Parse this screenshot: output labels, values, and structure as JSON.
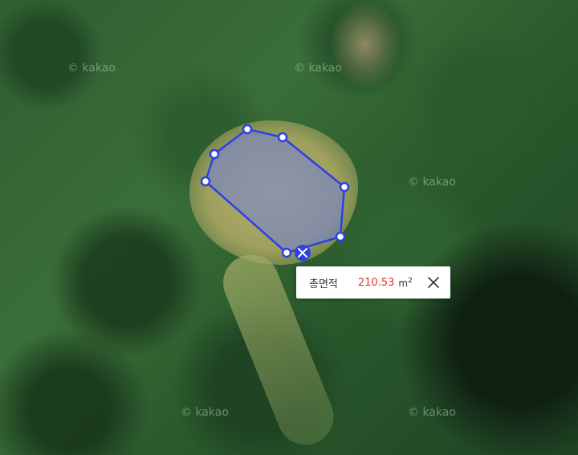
{
  "map": {
    "watermark_text": "© kakao"
  },
  "popup": {
    "label": "총면적",
    "value": "210.53",
    "unit": "m",
    "unit_sup": "2"
  },
  "colors": {
    "polygon_stroke": "#2f3fe6",
    "polygon_fill": "#6f7fd8",
    "area_value": "#e3342f"
  },
  "icons": {
    "vertex": "vertex-handle-icon",
    "delete": "delete-shape-icon",
    "close": "close-icon"
  }
}
